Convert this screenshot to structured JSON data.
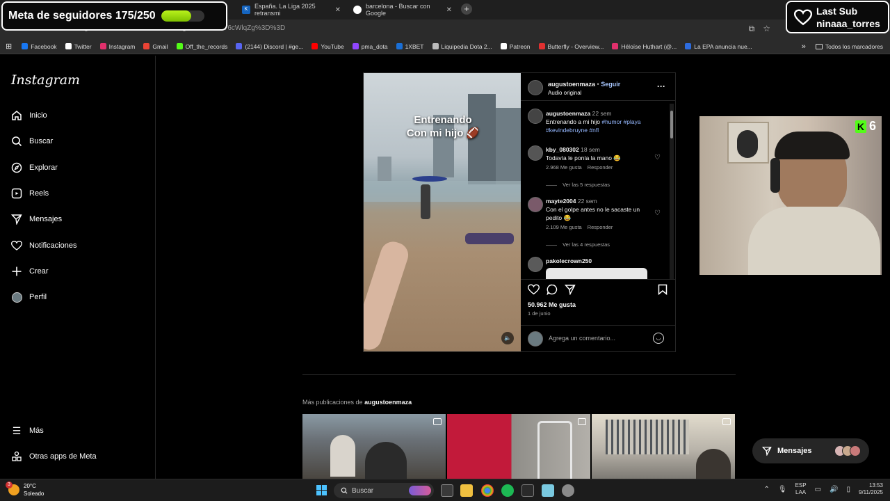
{
  "overlay": {
    "goal_label": "Meta de seguidores 175/250",
    "goal_progress": 0.7,
    "last_sub_title": "Last Sub",
    "last_sub_name": "ninaaa_torres",
    "kick_count": "6",
    "kick_letter": "K"
  },
  "browser": {
    "tabs": [
      {
        "label": "España. La Liga 2025 retransmi"
      },
      {
        "label": "barcelona - Buscar con Google"
      }
    ],
    "tab_icon_text": "K",
    "url": "instagram.com/reel/DKxxxxxxxxxx/?igsh=MWoJMV6cWlqZg%3D%3D",
    "bookmarks": [
      {
        "label": "Facebook",
        "color": "#1877f2"
      },
      {
        "label": "Twitter",
        "color": "#ffffff"
      },
      {
        "label": "Instagram",
        "color": "#e1306c"
      },
      {
        "label": "Gmail",
        "color": "#ea4335"
      },
      {
        "label": "Off_the_records",
        "color": "#53fc18"
      },
      {
        "label": "(2144) Discord | #ge...",
        "color": "#5865f2"
      },
      {
        "label": "YouTube",
        "color": "#ff0000"
      },
      {
        "label": "pma_dota",
        "color": "#9146ff"
      },
      {
        "label": "1XBET",
        "color": "#1a6fd6"
      },
      {
        "label": "Liquipedia Dota 2...",
        "color": "#bbbbbb"
      },
      {
        "label": "Patreon",
        "color": "#ffffff"
      },
      {
        "label": "Butterfly - Overview...",
        "color": "#e03030"
      },
      {
        "label": "Héloïse Huthart (@...",
        "color": "#e1306c"
      },
      {
        "label": "La EPA anuncia nue...",
        "color": "#2d6cdf"
      }
    ],
    "all_bookmarks": "Todos los marcadores"
  },
  "sidebar": {
    "logo": "Instagram",
    "items": [
      {
        "label": "Inicio",
        "icon": "home-icon"
      },
      {
        "label": "Buscar",
        "icon": "search-icon"
      },
      {
        "label": "Explorar",
        "icon": "compass-icon"
      },
      {
        "label": "Reels",
        "icon": "reels-icon"
      },
      {
        "label": "Mensajes",
        "icon": "send-icon"
      },
      {
        "label": "Notificaciones",
        "icon": "heart-icon"
      },
      {
        "label": "Crear",
        "icon": "plus-icon"
      },
      {
        "label": "Perfil",
        "icon": "avatar-icon"
      }
    ],
    "more": "Más",
    "meta_apps": "Otras apps de Meta"
  },
  "post": {
    "media_caption_line1": "Entrenando",
    "media_caption_line2": "Con mi hijo 🏈",
    "author": "augustoenmaza",
    "follow": "Seguir",
    "separator": "•",
    "audio": "Audio original",
    "caption_author": "augustoenmaza",
    "caption_time": "22 sem",
    "caption_text": "Entrenando a mi hijo",
    "caption_tags": [
      "#humor",
      "#playa",
      "#kevindebruyne",
      "#nfl"
    ],
    "comments": [
      {
        "user": "kby_080302",
        "time": "18 sem",
        "text": "Todavía le ponía la mano 😂",
        "likes": "2.968 Me gusta",
        "reply": "Responder",
        "replies": "Ver las 5 respuestas"
      },
      {
        "user": "mayte2004",
        "time": "22 sem",
        "text": "Con el golpe antes no le sacaste un pedito 😂",
        "likes": "2.109 Me gusta",
        "reply": "Responder",
        "replies": "Ver las 4 respuestas"
      },
      {
        "user": "pakolecrown250"
      }
    ],
    "likes": "50.962 Me gusta",
    "date": "1 de junio",
    "add_comment_placeholder": "Agrega un comentario..."
  },
  "more_posts": {
    "label": "Más publicaciones de",
    "user": "augustoenmaza"
  },
  "messages_pill": "Mensajes",
  "taskbar": {
    "weather_temp": "20°C",
    "weather_desc": "Soleado",
    "weather_badge": "3",
    "search": "Buscar",
    "lang1": "ESP",
    "lang2": "LAA",
    "time": "13:53",
    "date": "9/11/2025"
  }
}
